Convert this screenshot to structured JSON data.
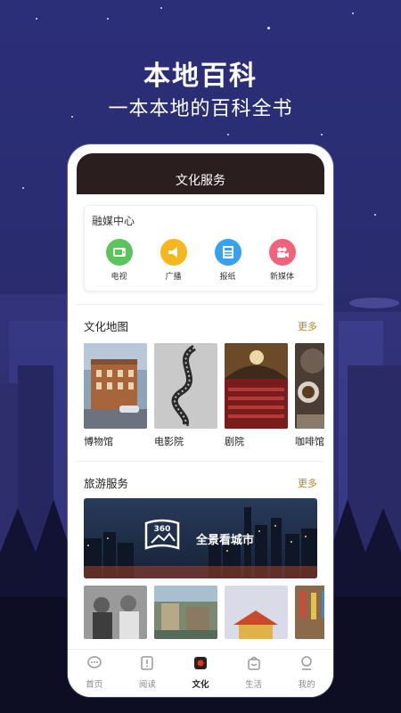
{
  "hero": {
    "title": "本地百科",
    "subtitle": "一本本地的百科全书"
  },
  "app": {
    "header_title": "文化服务",
    "media_center": {
      "title": "融媒中心",
      "items": [
        {
          "label": "电视",
          "icon": "tv-icon",
          "color": "#5cc45c"
        },
        {
          "label": "广播",
          "icon": "broadcast-icon",
          "color": "#f4b81e"
        },
        {
          "label": "报纸",
          "icon": "newspaper-icon",
          "color": "#3aa0f0"
        },
        {
          "label": "新媒体",
          "icon": "camera-icon",
          "color": "#f0637a"
        }
      ]
    },
    "culture_map": {
      "title": "文化地图",
      "more": "更多",
      "items": [
        {
          "label": "博物馆"
        },
        {
          "label": "电影院"
        },
        {
          "label": "剧院"
        },
        {
          "label": "咖啡馆"
        }
      ]
    },
    "travel": {
      "title": "旅游服务",
      "more": "更多",
      "banner_text": "全景看城市",
      "banner_badge": "360"
    },
    "tabs": [
      {
        "label": "首页",
        "icon": "home-chat-icon",
        "active": false
      },
      {
        "label": "阅读",
        "icon": "read-icon",
        "active": false
      },
      {
        "label": "文化",
        "icon": "culture-icon",
        "active": true
      },
      {
        "label": "生活",
        "icon": "life-bag-icon",
        "active": false
      },
      {
        "label": "我的",
        "icon": "profile-icon",
        "active": false
      }
    ]
  },
  "colors": {
    "accent_more": "#b8872a",
    "header_bg": "#2a1f1e",
    "active_tab": "#e0322b"
  }
}
